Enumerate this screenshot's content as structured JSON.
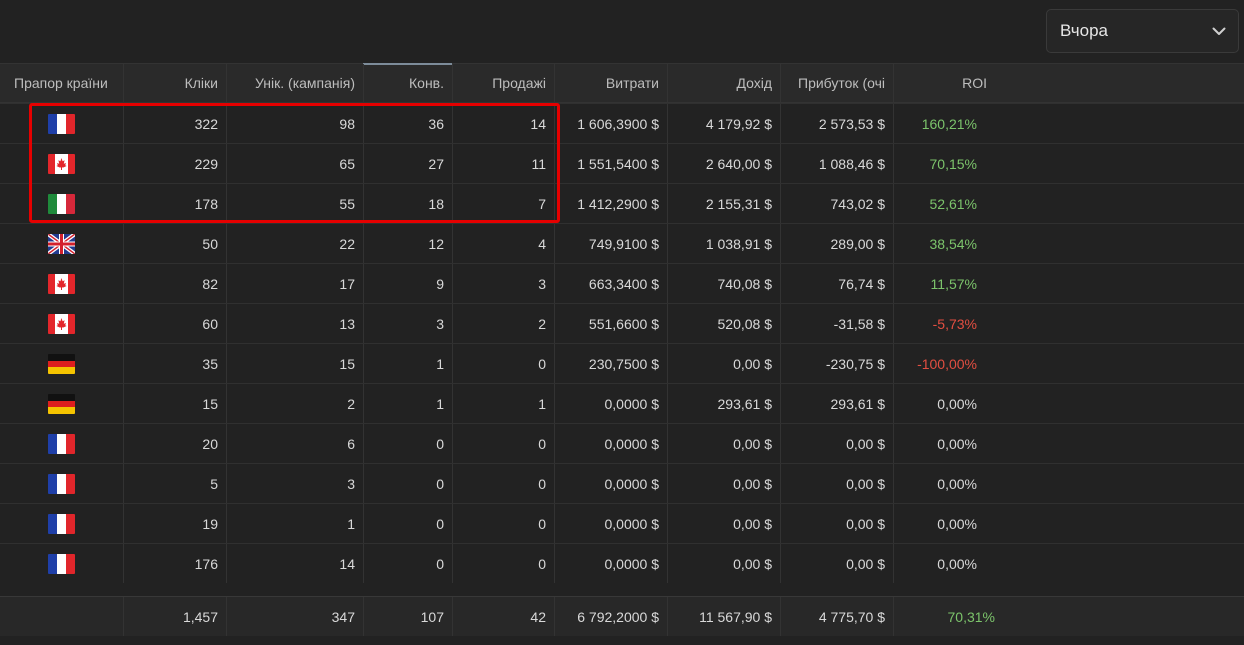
{
  "period": {
    "value": "Вчора",
    "icon": "chevron-down-icon"
  },
  "table": {
    "headers": {
      "flag": "Прапор країни",
      "clicks": "Кліки",
      "uniq": "Унік. (кампанія)",
      "conv": "Конв.",
      "sales": "Продажі",
      "cost": "Витрати",
      "income": "Дохід",
      "profit": "Прибуток (очі",
      "roi": "ROI"
    },
    "rows": [
      {
        "flag": "fr",
        "clicks": "322",
        "uniq": "98",
        "conv": "36",
        "sales": "14",
        "cost": "1 606,3900 $",
        "income": "4 179,92 $",
        "profit": "2 573,53 $",
        "roi": "160,21%",
        "roi_sign": "pos"
      },
      {
        "flag": "ca",
        "clicks": "229",
        "uniq": "65",
        "conv": "27",
        "sales": "11",
        "cost": "1 551,5400 $",
        "income": "2 640,00 $",
        "profit": "1 088,46 $",
        "roi": "70,15%",
        "roi_sign": "pos"
      },
      {
        "flag": "it",
        "clicks": "178",
        "uniq": "55",
        "conv": "18",
        "sales": "7",
        "cost": "1 412,2900 $",
        "income": "2 155,31 $",
        "profit": "743,02 $",
        "roi": "52,61%",
        "roi_sign": "pos"
      },
      {
        "flag": "gb",
        "clicks": "50",
        "uniq": "22",
        "conv": "12",
        "sales": "4",
        "cost": "749,9100 $",
        "income": "1 038,91 $",
        "profit": "289,00 $",
        "roi": "38,54%",
        "roi_sign": "pos"
      },
      {
        "flag": "ca",
        "clicks": "82",
        "uniq": "17",
        "conv": "9",
        "sales": "3",
        "cost": "663,3400 $",
        "income": "740,08 $",
        "profit": "76,74 $",
        "roi": "11,57%",
        "roi_sign": "pos"
      },
      {
        "flag": "ca",
        "clicks": "60",
        "uniq": "13",
        "conv": "3",
        "sales": "2",
        "cost": "551,6600 $",
        "income": "520,08 $",
        "profit": "-31,58 $",
        "roi": "-5,73%",
        "roi_sign": "neg"
      },
      {
        "flag": "de",
        "clicks": "35",
        "uniq": "15",
        "conv": "1",
        "sales": "0",
        "cost": "230,7500 $",
        "income": "0,00 $",
        "profit": "-230,75 $",
        "roi": "-100,00%",
        "roi_sign": "neg"
      },
      {
        "flag": "de",
        "clicks": "15",
        "uniq": "2",
        "conv": "1",
        "sales": "1",
        "cost": "0,0000 $",
        "income": "293,61 $",
        "profit": "293,61 $",
        "roi": "0,00%",
        "roi_sign": "zero"
      },
      {
        "flag": "fr",
        "clicks": "20",
        "uniq": "6",
        "conv": "0",
        "sales": "0",
        "cost": "0,0000 $",
        "income": "0,00 $",
        "profit": "0,00 $",
        "roi": "0,00%",
        "roi_sign": "zero"
      },
      {
        "flag": "fr",
        "clicks": "5",
        "uniq": "3",
        "conv": "0",
        "sales": "0",
        "cost": "0,0000 $",
        "income": "0,00 $",
        "profit": "0,00 $",
        "roi": "0,00%",
        "roi_sign": "zero"
      },
      {
        "flag": "fr",
        "clicks": "19",
        "uniq": "1",
        "conv": "0",
        "sales": "0",
        "cost": "0,0000 $",
        "income": "0,00 $",
        "profit": "0,00 $",
        "roi": "0,00%",
        "roi_sign": "zero"
      },
      {
        "flag": "fr",
        "clicks": "176",
        "uniq": "14",
        "conv": "0",
        "sales": "0",
        "cost": "0,0000 $",
        "income": "0,00 $",
        "profit": "0,00 $",
        "roi": "0,00%",
        "roi_sign": "zero"
      }
    ],
    "totals": {
      "clicks": "1,457",
      "uniq": "347",
      "conv": "107",
      "sales": "42",
      "cost": "6 792,2000 $",
      "income": "11 567,90 $",
      "profit": "4 775,70 $",
      "roi": "70,31%"
    }
  },
  "colors": {
    "positive": "#7cc46b",
    "negative": "#e24e41",
    "highlight": "#e60000"
  }
}
